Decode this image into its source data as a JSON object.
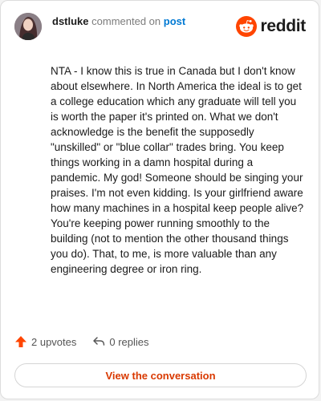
{
  "header": {
    "username": "dstluke",
    "action": "commented on",
    "post_link": "post"
  },
  "brand": {
    "wordmark": "reddit",
    "icon": "reddit-snoo-icon",
    "color": "#ff4500"
  },
  "comment": {
    "text": "NTA - I know this is true in Canada but I don't know about elsewhere. In North America the ideal is to get a college education which any graduate will tell you is worth the paper it's printed on. What we don't acknowledge is the benefit the supposedly \"unskilled\" or \"blue collar\" trades bring. You keep things working in a damn hospital during a pandemic. My god! Someone should be singing your praises. I'm not even kidding. Is your girlfriend aware how many machines in a hospital keep people alive? You're keeping power running smoothly to the building (not to mention the other thousand things you do). That, to me, is more valuable than any engineering degree or iron ring."
  },
  "footer": {
    "upvotes": "2 upvotes",
    "upvote_icon": "upvote-arrow-icon",
    "replies": "0 replies",
    "reply_icon": "reply-arrow-icon"
  },
  "cta": {
    "label": "View the conversation",
    "color": "#d93900"
  }
}
